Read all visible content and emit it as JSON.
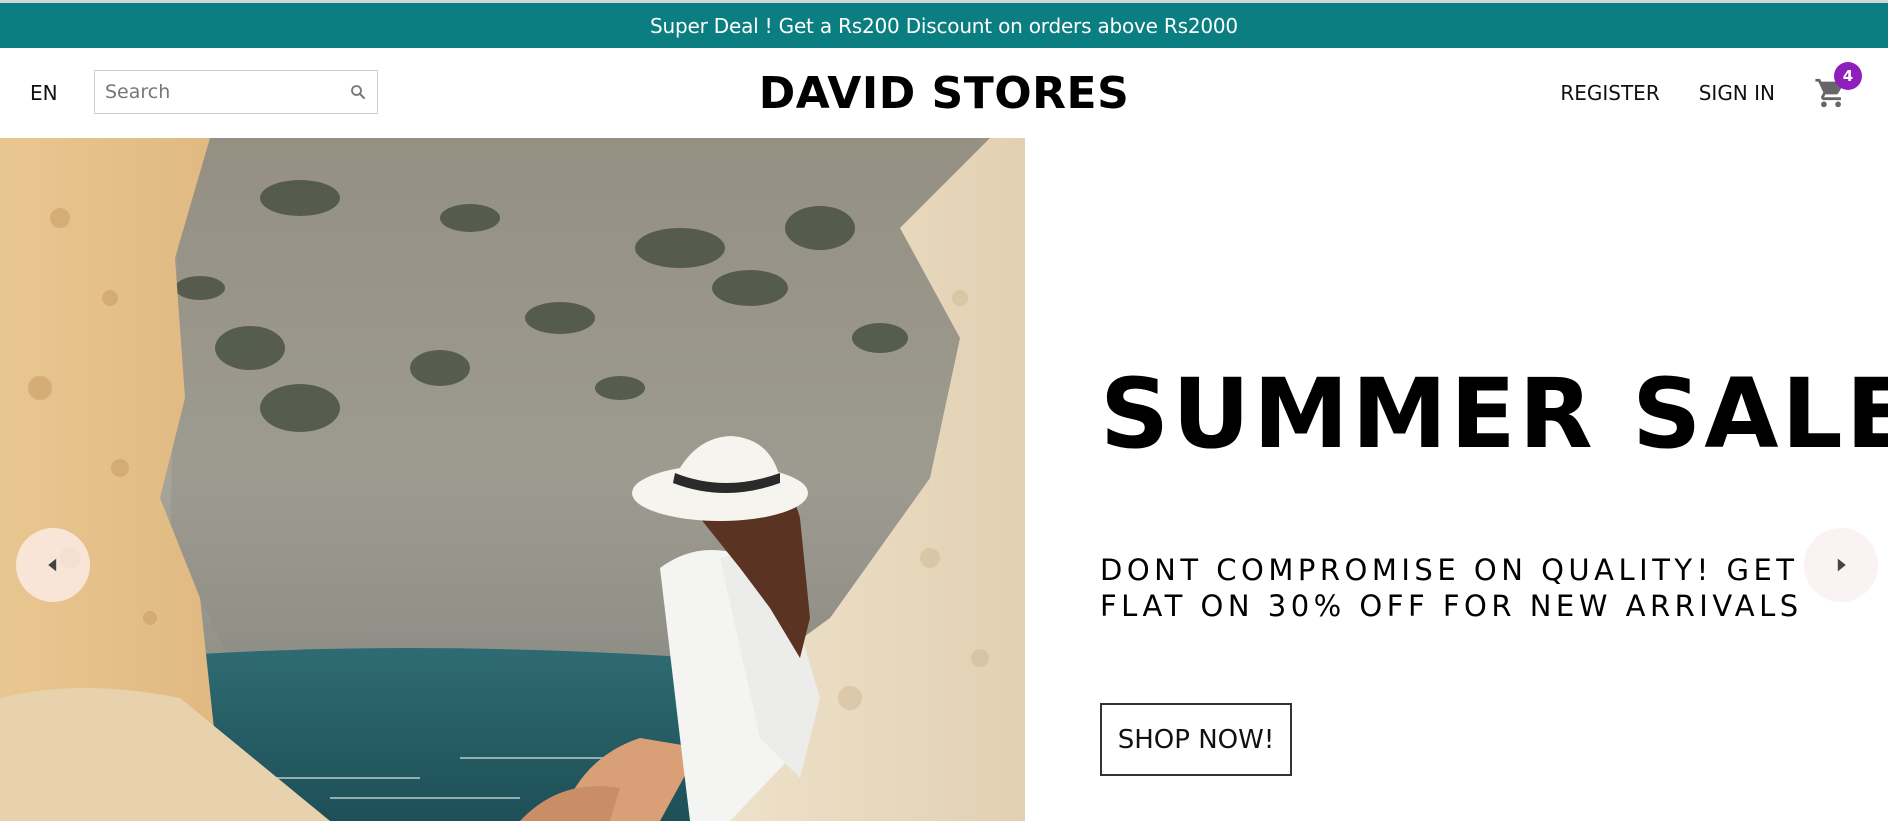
{
  "announcement": {
    "text": "Super Deal ! Get a Rs200 Discount on orders above Rs2000"
  },
  "navbar": {
    "language": "EN",
    "search_placeholder": "Search",
    "brand": "DAVID STORES",
    "register": "REGISTER",
    "sign_in": "SIGN IN",
    "cart_count": "4"
  },
  "hero": {
    "title": "SUMMER SALE",
    "description": "DONT COMPROMISE ON QUALITY! GET FLAT ON 30% OFF FOR NEW ARRIVALS",
    "button_label": "SHOP NOW!"
  },
  "colors": {
    "announcement_bg": "#0a7e80",
    "badge_bg": "#8e1fbd"
  },
  "icons": [
    "search-icon",
    "cart-icon",
    "chevron-left-icon",
    "chevron-right-icon"
  ]
}
